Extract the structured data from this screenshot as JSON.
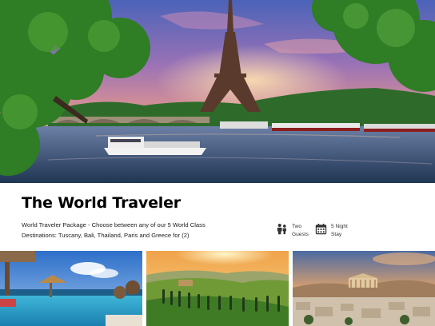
{
  "hero": {
    "image": "eiffel-tower-seine-sunset-photo"
  },
  "package": {
    "title": "The World Traveler",
    "description_line1": "World Traveler Package - Choose between any of our 5 World Class",
    "description_line2": "Destinations: Tuscany, Bali, Thailand, Paris and Greece for (2)"
  },
  "features": [
    {
      "icon": "guests-icon",
      "line1": "Two",
      "line2": "Guests"
    },
    {
      "icon": "calendar-icon",
      "line1": "5 Night",
      "line2": "Stay"
    }
  ],
  "gallery": [
    {
      "image": "bali-pool-photo"
    },
    {
      "image": "tuscany-hills-photo"
    },
    {
      "image": "athens-acropolis-photo"
    }
  ]
}
